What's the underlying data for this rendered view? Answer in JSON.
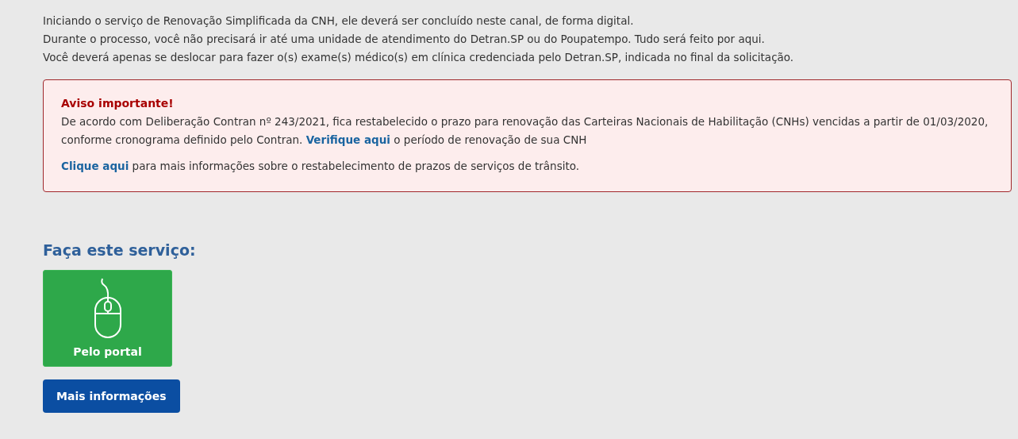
{
  "intro": [
    "Iniciando o serviço de Renovação Simplificada da CNH, ele deverá ser concluído neste canal, de forma digital.",
    "Durante o processo, você não precisará ir até uma unidade de atendimento do Detran.SP ou do Poupatempo. Tudo será feito por aqui.",
    "Você deverá apenas se deslocar para fazer o(s) exame(s) médico(s) em clínica credenciada pelo Detran.SP, indicada no final da solicitação."
  ],
  "alert": {
    "title": "Aviso importante!",
    "paragraphs": [
      [
        {
          "kind": "text",
          "text": "De acordo com Deliberação Contran nº 243/2021, fica restabelecido o prazo para renovação das Carteiras Nacionais de Habilitação (CNHs) vencidas a partir de 01/03/2020, conforme cronograma definido pelo Contran. "
        },
        {
          "kind": "link",
          "text": "Verifique aqui"
        },
        {
          "kind": "text",
          "text": " o período de renovação de sua CNH"
        }
      ],
      [
        {
          "kind": "link",
          "text": "Clique aqui"
        },
        {
          "kind": "text",
          "text": " para mais informações sobre o restabelecimento de prazos de serviços de trânsito."
        }
      ]
    ]
  },
  "service": {
    "heading": "Faça este serviço:",
    "tile": "Pelo portal",
    "more_button": "Mais informações"
  }
}
